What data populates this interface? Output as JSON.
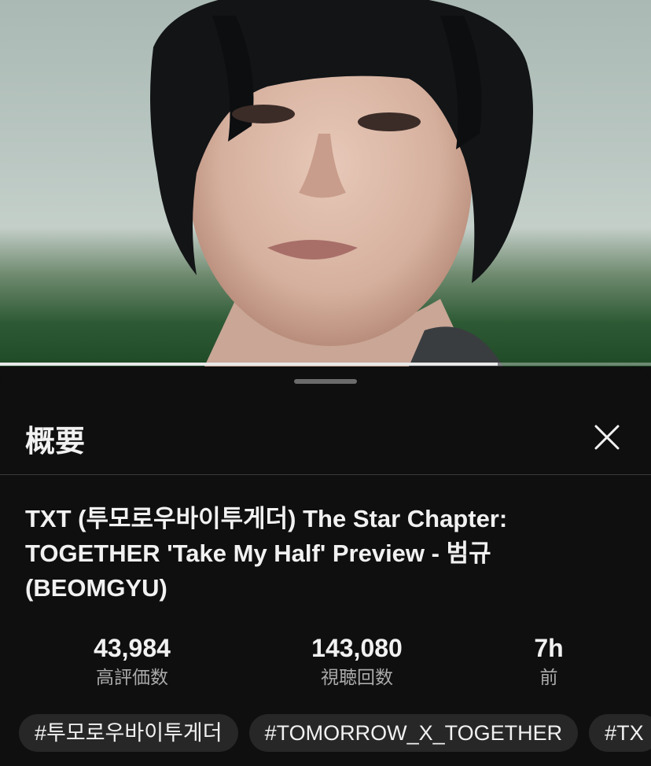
{
  "video": {
    "progress_fraction": 0.765
  },
  "panel": {
    "title": "概要",
    "close_icon": "close-icon"
  },
  "description": {
    "title": "TXT (투모로우바이투게더) The Star Chapter: TOGETHER 'Take My Half' Preview - 범규 (BEOMGYU)",
    "title_lines": [
      "TXT (투모로우바이투게더) The Star Chapter:",
      "TOGETHER 'Take My Half' Preview - 범규",
      "(BEOMGYU)"
    ]
  },
  "stats": [
    {
      "value": "43,984",
      "label": "高評価数"
    },
    {
      "value": "143,080",
      "label": "視聴回数"
    },
    {
      "value": "7h",
      "label": "前"
    }
  ],
  "hashtags": [
    "#투모로우바이투게더",
    "#TOMORROW_X_TOGETHER",
    "#TX"
  ]
}
